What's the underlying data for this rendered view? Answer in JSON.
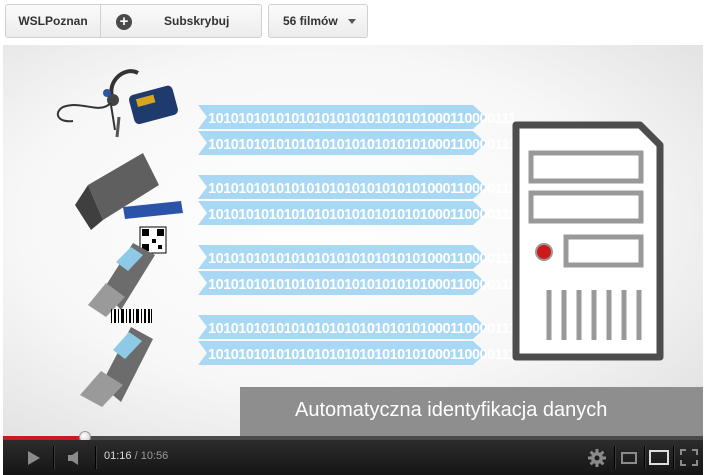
{
  "header": {
    "channel_name": "WSLPoznan",
    "subscribe_label": "Subskrybuj",
    "video_count_label": "56 filmów"
  },
  "video": {
    "caption": "Automatyczna identyfikacja danych",
    "binary_stream": "10101010101010101010101010101000110000111"
  },
  "player": {
    "current_time": "01:16",
    "separator": "/",
    "duration": "10:56",
    "progress_fraction": 0.117,
    "accent_color": "#cc181e"
  },
  "icons": [
    "plus-circle-icon",
    "caret-down-icon",
    "play-icon",
    "volume-icon",
    "settings-icon",
    "small-player-icon",
    "large-player-icon",
    "fullscreen-icon"
  ]
}
